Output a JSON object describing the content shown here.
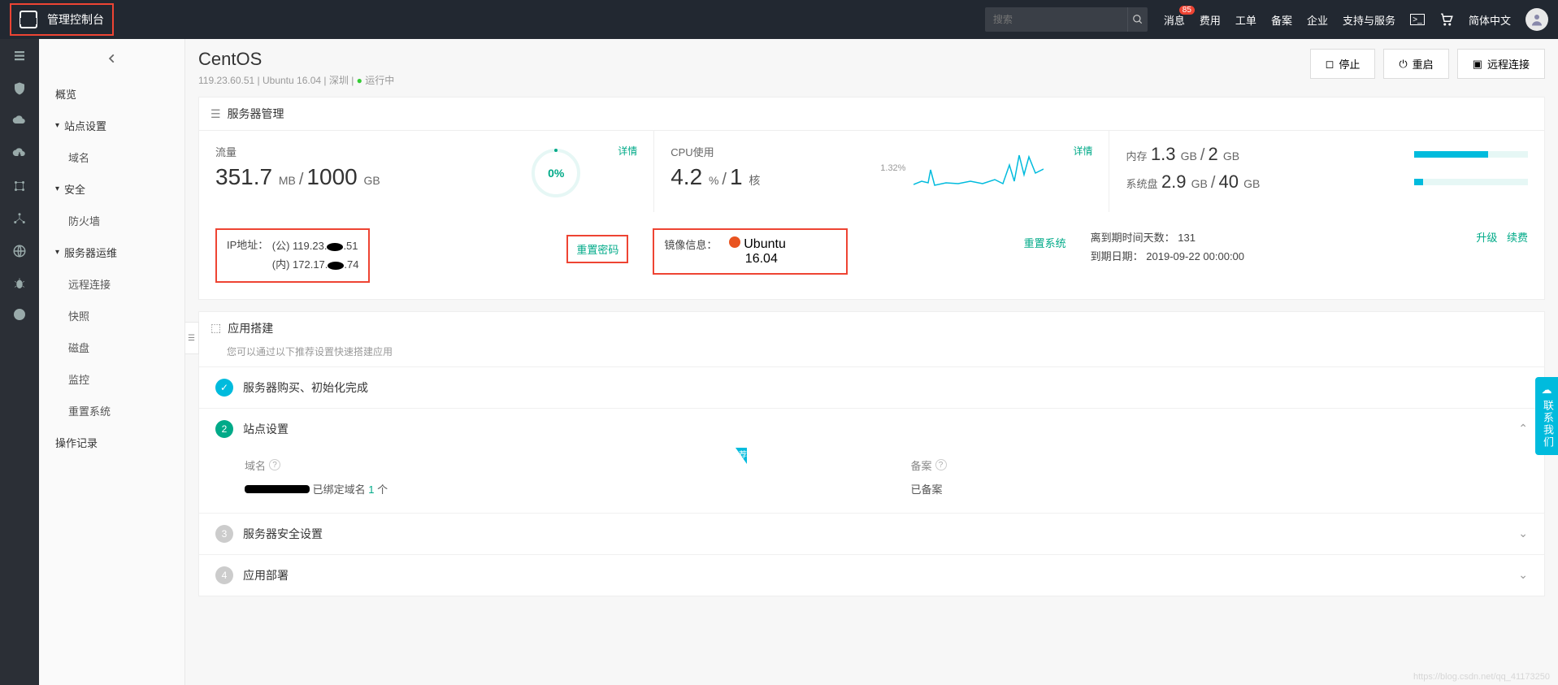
{
  "header": {
    "console_title": "管理控制台",
    "search_placeholder": "搜索",
    "nav": {
      "messages": "消息",
      "messages_badge": "85",
      "cost": "费用",
      "orders": "工单",
      "record": "备案",
      "enterprise": "企业",
      "support": "支持与服务",
      "lang": "简体中文"
    }
  },
  "sidebar": {
    "overview": "概览",
    "site": "站点设置",
    "site_domain": "域名",
    "security": "安全",
    "firewall": "防火墙",
    "ops": "服务器运维",
    "ops_items": {
      "remote": "远程连接",
      "snapshot": "快照",
      "disk": "磁盘",
      "monitor": "监控",
      "reset": "重置系统"
    },
    "oplog": "操作记录"
  },
  "page": {
    "title": "CentOS",
    "ip": "119.23.60.51",
    "os": "Ubuntu 16.04",
    "region": "深圳",
    "status": "运行中",
    "actions": {
      "stop": "停止",
      "restart": "重启",
      "remote": "远程连接"
    }
  },
  "server_mgmt": {
    "title": "服务器管理",
    "traffic": {
      "label": "流量",
      "used": "351.7",
      "used_unit": "MB",
      "total": "1000",
      "total_unit": "GB",
      "pct": "0%",
      "detail": "详情"
    },
    "cpu": {
      "label": "CPU使用",
      "value": "4.2",
      "unit": "%",
      "cores": "1",
      "cores_unit": "核",
      "peak": "1.32%",
      "detail": "详情"
    },
    "mem": {
      "label": "内存",
      "used": "1.3",
      "total": "2",
      "unit": "GB"
    },
    "disk": {
      "label": "系统盘",
      "used": "2.9",
      "total": "40",
      "unit": "GB"
    },
    "ip": {
      "label": "IP地址：",
      "pub_prefix": "(公) 119.23.",
      "pub_suffix": ".51",
      "pri_prefix": "(内) 172.17.",
      "pri_suffix": ".74",
      "reset_pw": "重置密码"
    },
    "image": {
      "label": "镜像信息：",
      "name": "Ubuntu",
      "ver": "16.04",
      "reset_sys": "重置系统"
    },
    "expire": {
      "days_label": "离到期时间天数：",
      "days": "131",
      "date_label": "到期日期：",
      "date": "2019-09-22 00:00:00",
      "upgrade": "升级",
      "renew": "续费"
    }
  },
  "app_build": {
    "title": "应用搭建",
    "subtitle": "您可以通过以下推荐设置快速搭建应用",
    "steps": {
      "s1": "服务器购买、初始化完成",
      "s2": "站点设置",
      "s3": "服务器安全设置",
      "s4": "应用部署"
    },
    "s2_body": {
      "domain_label": "域名",
      "domain_bound": "已绑定域名",
      "domain_count": "1",
      "domain_unit": "个",
      "record_label": "备案",
      "record_status": "已备案"
    }
  },
  "contact": "联系我们",
  "watermark": "https://blog.csdn.net/qq_41173250"
}
